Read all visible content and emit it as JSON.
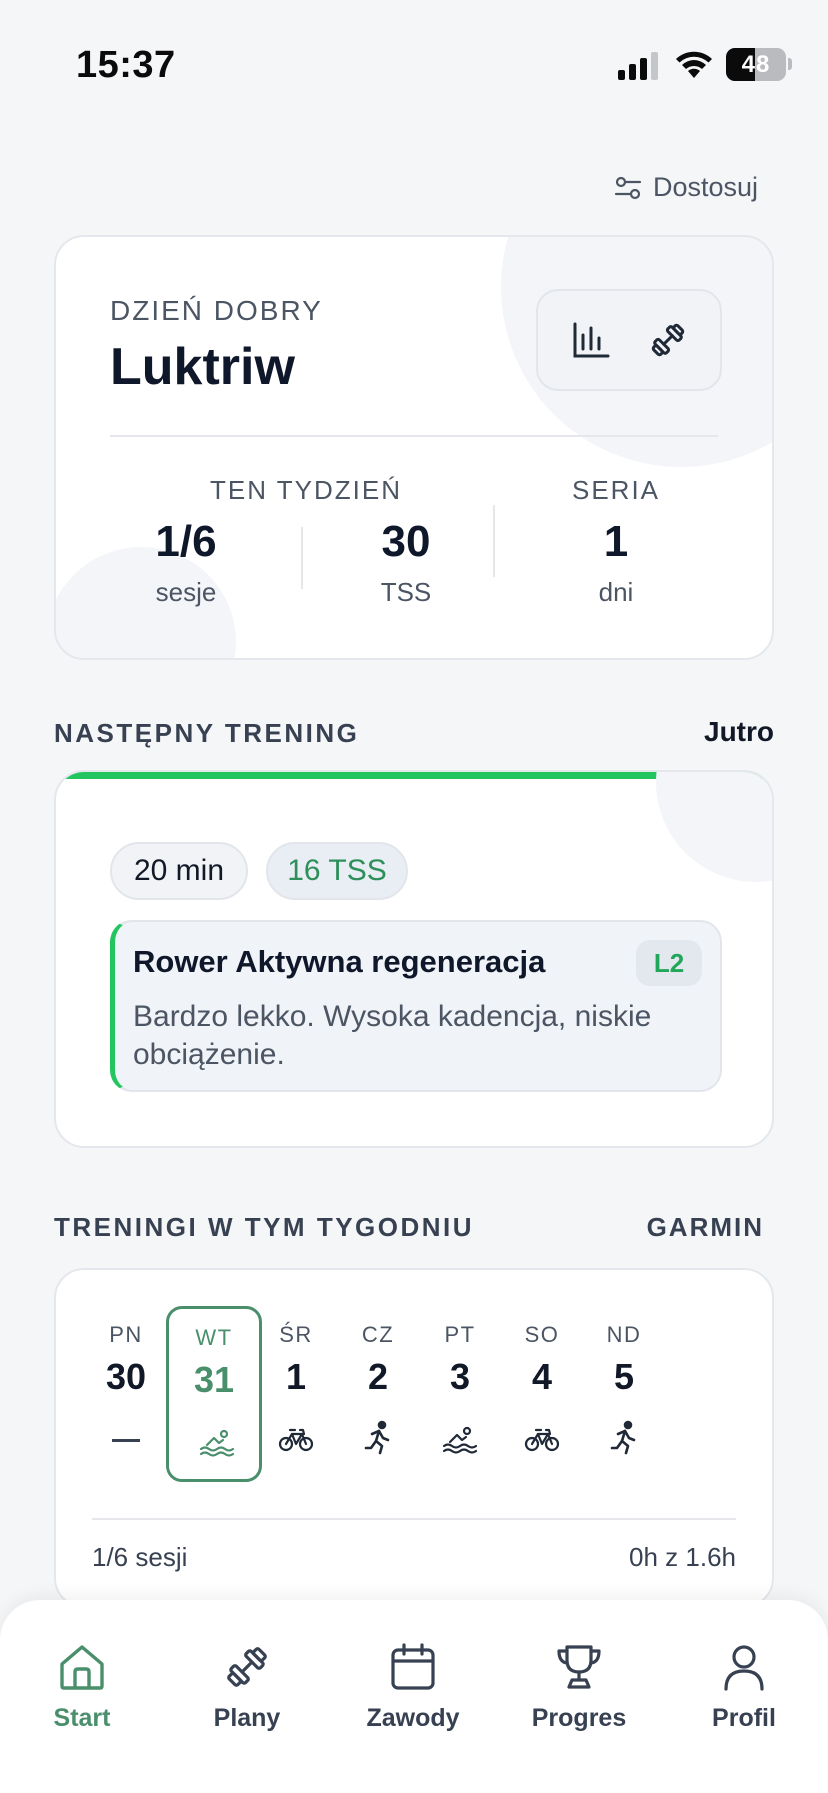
{
  "status_bar": {
    "time": "15:37",
    "battery": "48",
    "battery_level": 0.48
  },
  "header": {
    "customize_label": "Dostosuj"
  },
  "greeting": {
    "small": "DZIEŃ DOBRY",
    "name": "Luktriw",
    "quick_actions": [
      "bar-chart-icon",
      "dumbbell-icon"
    ],
    "this_week_label": "TEN TYDZIEŃ",
    "sessions_value": "1/6",
    "sessions_unit": "sesje",
    "tss_value": "30",
    "tss_unit": "TSS",
    "streak_label": "SERIA",
    "streak_value": "1",
    "streak_unit": "dni"
  },
  "next_training": {
    "section_title": "NASTĘPNY TRENING",
    "when": "Jutro",
    "duration": "20 min",
    "tss": "16 TSS",
    "title": "Rower Aktywna regeneracja",
    "level": "L2",
    "description": "Bardzo lekko. Wysoka kadencja, niskie obciążenie.",
    "accent": "#22c55e"
  },
  "week": {
    "section_title": "TRENINGI W TYM TYGODNIU",
    "source": "GARMIN",
    "days": [
      {
        "abbr": "PN",
        "num": "30",
        "icon": "none"
      },
      {
        "abbr": "WT",
        "num": "31",
        "icon": "swim-icon",
        "active": true
      },
      {
        "abbr": "ŚR",
        "num": "1",
        "icon": "bike-icon"
      },
      {
        "abbr": "CZ",
        "num": "2",
        "icon": "run-icon"
      },
      {
        "abbr": "PT",
        "num": "3",
        "icon": "swim-icon"
      },
      {
        "abbr": "SO",
        "num": "4",
        "icon": "bike-icon"
      },
      {
        "abbr": "ND",
        "num": "5",
        "icon": "run-icon"
      }
    ],
    "sessions_summary": "1/6 sesji",
    "hours_summary": "0h z 1.6h",
    "accent": "#4a8f6c"
  },
  "bottom_nav": {
    "items": [
      {
        "label": "Start",
        "icon": "home-icon",
        "active": true
      },
      {
        "label": "Plany",
        "icon": "dumbbell-icon"
      },
      {
        "label": "Zawody",
        "icon": "calendar-icon"
      },
      {
        "label": "Progres",
        "icon": "trophy-icon"
      },
      {
        "label": "Profil",
        "icon": "user-icon"
      }
    ],
    "active_color": "#4a8f6c"
  }
}
